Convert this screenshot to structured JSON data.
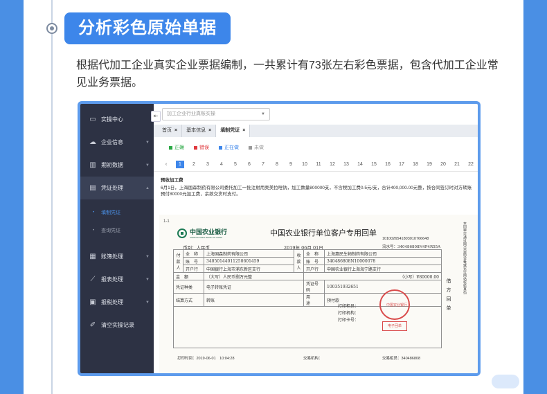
{
  "header": {
    "pill_title": "分析彩色原始单据",
    "description": "根据代加工企业真实企业票据编制，一共累计有73张左右彩色票据，包含代加工企业常见业务票据。"
  },
  "sidebar": {
    "items": [
      {
        "label": "实操中心",
        "icon": "monitor-icon"
      },
      {
        "label": "企业信息",
        "icon": "cloud-icon"
      },
      {
        "label": "期初数据",
        "icon": "bar-chart-icon"
      },
      {
        "label": "凭证处理",
        "icon": "voucher-icon"
      },
      {
        "label": "账簿处理",
        "icon": "ledger-icon"
      },
      {
        "label": "报表处理",
        "icon": "line-chart-icon"
      },
      {
        "label": "报税处理",
        "icon": "tax-icon"
      },
      {
        "label": "清空实操记录",
        "icon": "broom-icon"
      }
    ],
    "sub_items": [
      {
        "label": "填制凭证"
      },
      {
        "label": "查询凭证"
      }
    ],
    "collapse": "⇤"
  },
  "topbar": {
    "select_value": "加工企业行业真账实操"
  },
  "tabs": [
    {
      "label": "首页"
    },
    {
      "label": "基本信息"
    },
    {
      "label": "填制凭证"
    }
  ],
  "legend": [
    {
      "label": "正确",
      "color": "#2aa845"
    },
    {
      "label": "错误",
      "color": "#e0393e"
    },
    {
      "label": "正在做",
      "color": "#3d86ea"
    },
    {
      "label": "未做",
      "color": "#999999"
    }
  ],
  "pager": {
    "prev": "‹",
    "pages": [
      "1",
      "2",
      "3",
      "4",
      "5",
      "6",
      "7",
      "8",
      "9",
      "10",
      "11",
      "12",
      "13",
      "14",
      "15",
      "16",
      "17",
      "18",
      "19",
      "20",
      "21",
      "22"
    ],
    "current": "1"
  },
  "task": {
    "title": "预收加工费",
    "text": "6月1日，上海国森制药有限公司委托加工一批注射用奥美拉唑钠，加工数量800000支，不含税加工费0.5元/支，合计400,000.00元整，按合同签订时对方转账预付80000元加工费，余款交货时支付。"
  },
  "receipt": {
    "number": "1-1",
    "bank_name": "中国农业银行",
    "bank_eng": "AGRICULTURAL BANK OF CHINA",
    "title": "中国农业银行单位客户专用回单",
    "code": "1010026541803010766648",
    "currency": "币别：人民币",
    "date": "2019年 06月 01日",
    "serial": "流水号：340486808N4P4R55A",
    "payer_label": "付款人",
    "payee_label": "收款人",
    "name_label": "全　称",
    "account_label": "账　号",
    "bank_label": "开户行",
    "payer_name": "上海国森制药有限公司",
    "payer_account": "34050144011250601459",
    "payer_bank": "中国银行上海市浦东新区支行",
    "payee_name": "上海惠民生物制药有限公司",
    "payee_account": "340486808N10000078",
    "payee_bank": "中国农业银行上海海宁路支行",
    "amount_label": "金　额",
    "amount_big": "（大写）人民币捌万元整",
    "amount_small": "（小写）¥80000.00",
    "voucher_type_label": "凭证种类",
    "voucher_type": "电子转账凭证",
    "voucher_no_label": "凭证号码",
    "voucher_no": "100351932651",
    "settle_label": "结算方式",
    "settle": "转账",
    "usage_label": "用　　途",
    "usage": "预付款",
    "print_lines": [
      "打印柜员：",
      "打印机构：",
      "打印卡号："
    ],
    "stamp_text": "中国农业银行",
    "stamp_rect": "电子回单",
    "side_text": "本回单可通过网点自助设备或农行网站校验真伪",
    "side_label": "借方回单",
    "print_time": "打印时间：2019-06-01　10:04:28",
    "trade_org": "交易机构：",
    "trade_person": "交易柜员：340486808"
  }
}
